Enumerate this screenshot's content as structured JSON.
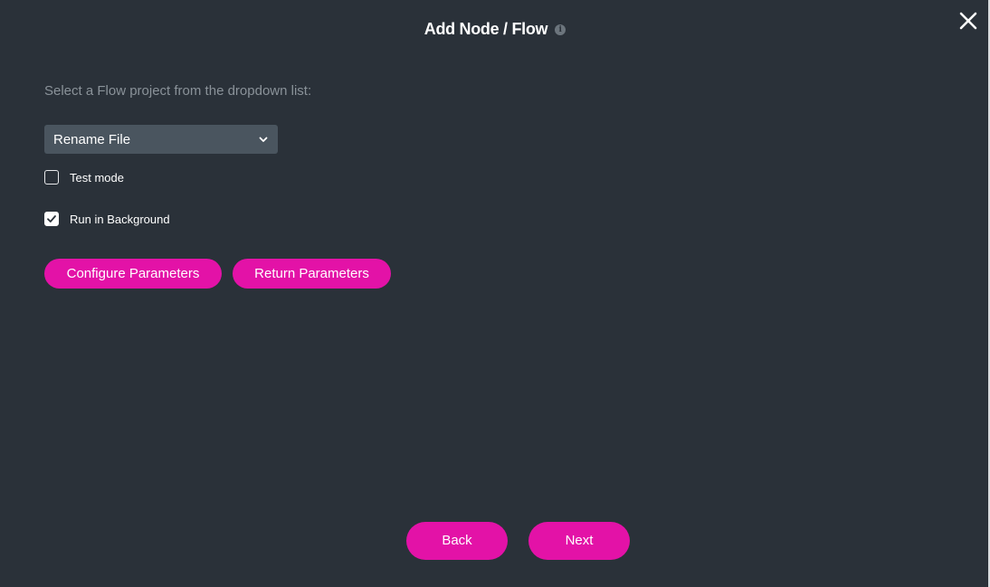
{
  "dialog": {
    "title": "Add Node / Flow",
    "info_glyph": "i",
    "prompt": "Select a Flow project from the dropdown list:"
  },
  "flow_select": {
    "selected": "Rename File"
  },
  "options": {
    "test_mode": {
      "label": "Test mode",
      "checked": false
    },
    "run_in_background": {
      "label": "Run in Background",
      "checked": true
    }
  },
  "actions": {
    "configure_parameters": "Configure Parameters",
    "return_parameters": "Return Parameters"
  },
  "footer": {
    "back": "Back",
    "next": "Next"
  },
  "theme": {
    "background": "#2a3139",
    "accent": "#e312a7",
    "dropdown_bg": "#4a555f",
    "muted_text": "#8a9299"
  },
  "icons": {
    "close": "close-icon",
    "info": "info-icon",
    "dropdown": "chevron-down-icon",
    "check": "checkmark-icon"
  }
}
